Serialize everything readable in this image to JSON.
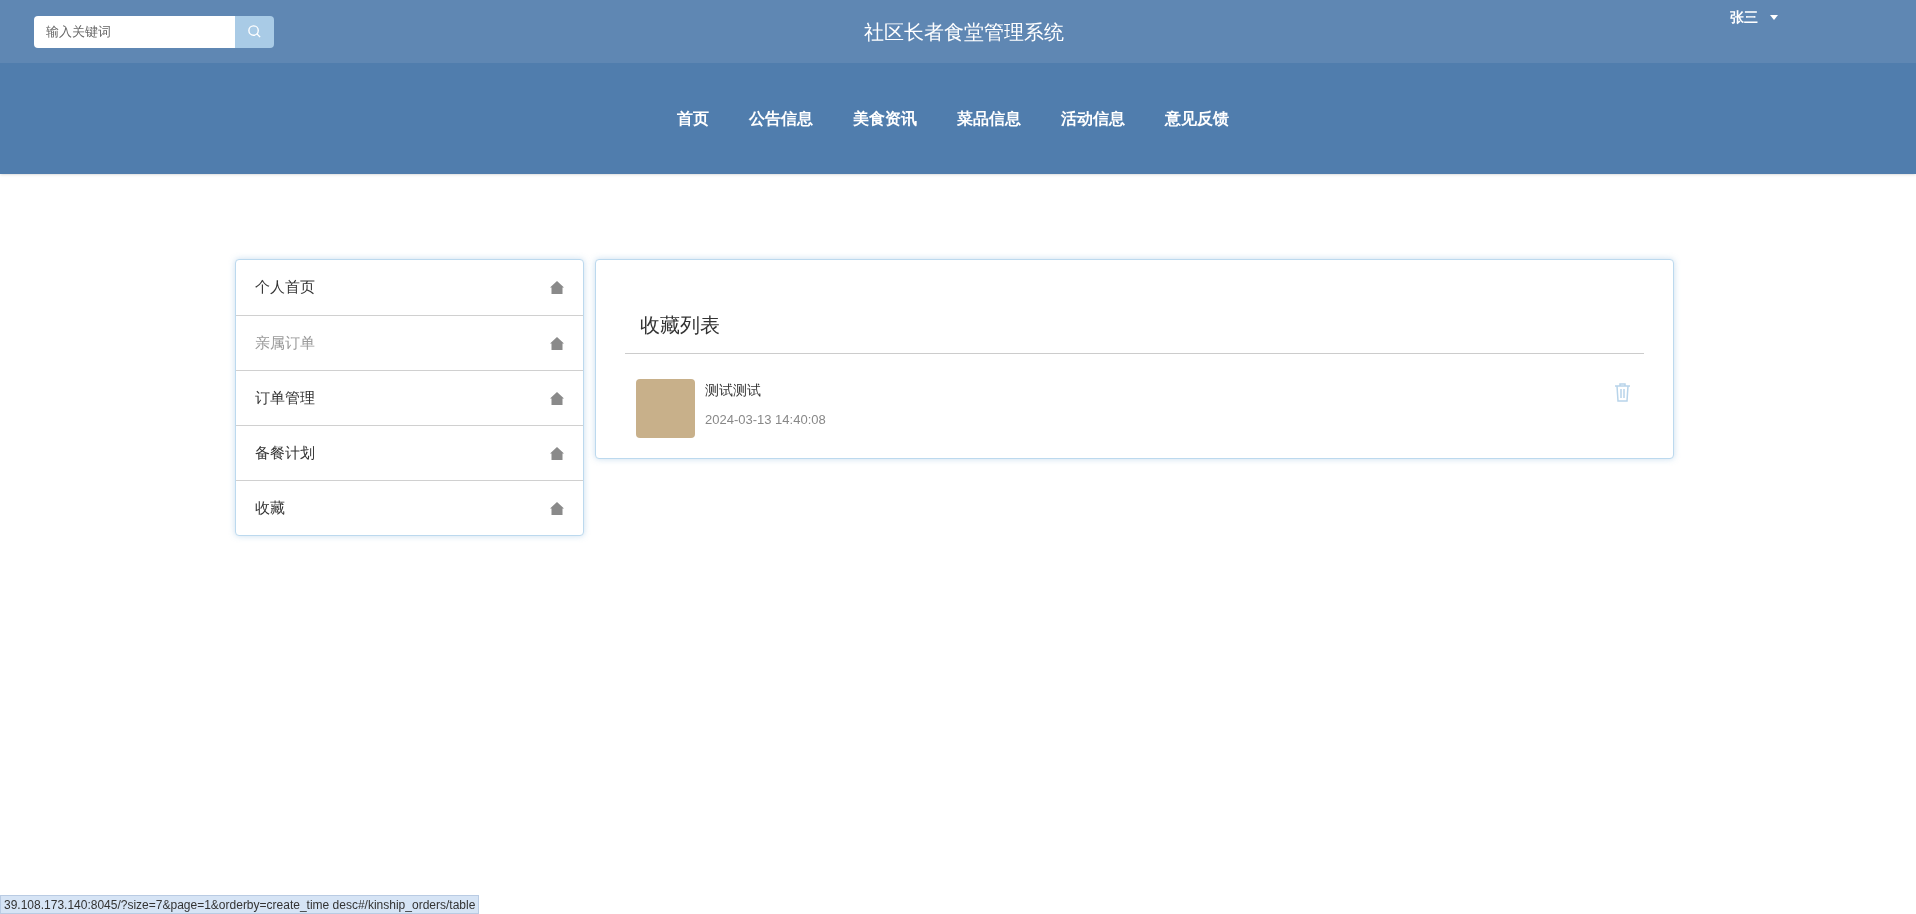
{
  "header": {
    "search": {
      "placeholder": "输入关键词"
    },
    "title": "社区长者食堂管理系统",
    "user": "张三"
  },
  "nav": [
    {
      "label": "首页"
    },
    {
      "label": "公告信息"
    },
    {
      "label": "美食资讯"
    },
    {
      "label": "菜品信息"
    },
    {
      "label": "活动信息"
    },
    {
      "label": "意见反馈"
    }
  ],
  "sidebar": {
    "items": [
      {
        "label": "个人首页",
        "hovered": false
      },
      {
        "label": "亲属订单",
        "hovered": true
      },
      {
        "label": "订单管理",
        "hovered": false
      },
      {
        "label": "备餐计划",
        "hovered": false
      },
      {
        "label": "收藏",
        "hovered": false
      }
    ]
  },
  "favorites": {
    "title": "收藏列表",
    "items": [
      {
        "name": "测试测试",
        "time": "2024-03-13 14:40:08"
      }
    ]
  },
  "status_bar": "39.108.173.140:8045/?size=7&page=1&orderby=create_time desc#/kinship_orders/table"
}
